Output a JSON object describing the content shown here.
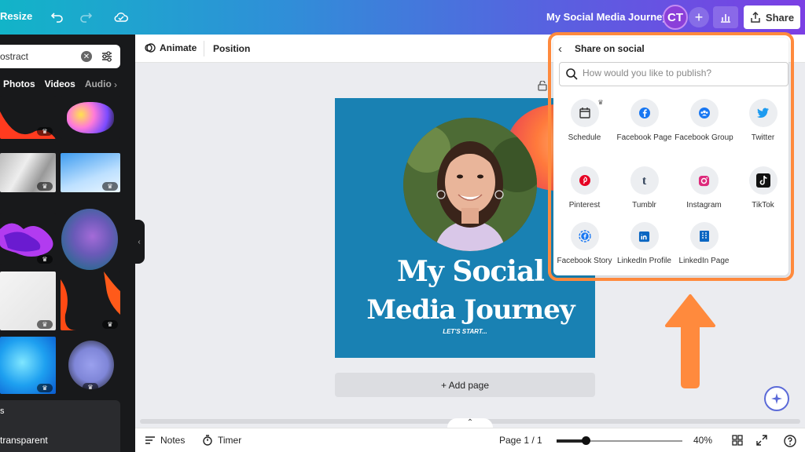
{
  "topbar": {
    "resize_label": "Resize",
    "doc_title": "My Social Media Journey",
    "avatar_initials": "CT",
    "plus": "+",
    "share_label": "Share"
  },
  "leftpanel": {
    "search_value": "ostract",
    "categories": [
      "Photos",
      "Videos",
      "Audio"
    ],
    "bottom_label_1": "s",
    "bottom_label_2": "transparent"
  },
  "canvas_toolbar": {
    "animate_label": "Animate",
    "position_label": "Position"
  },
  "design": {
    "title_line1": "My Social",
    "title_line2": "Media Journey",
    "subtitle": "LET'S START..."
  },
  "add_page_label": "+ Add page",
  "footer": {
    "notes_label": "Notes",
    "timer_label": "Timer",
    "page_label": "Page 1 / 1",
    "zoom_label": "40%",
    "zoom_level": 0.4
  },
  "share_popup": {
    "title": "Share on social",
    "search_placeholder": "How would you like to publish?",
    "options": [
      {
        "label": "Schedule",
        "icon": "calendar-icon"
      },
      {
        "label": "Facebook Page",
        "icon": "facebook-icon"
      },
      {
        "label": "Facebook Group",
        "icon": "facebook-group-icon"
      },
      {
        "label": "Twitter",
        "icon": "twitter-icon"
      },
      {
        "label": "Pinterest",
        "icon": "pinterest-icon"
      },
      {
        "label": "Tumblr",
        "icon": "tumblr-icon"
      },
      {
        "label": "Instagram",
        "icon": "instagram-icon"
      },
      {
        "label": "TikTok",
        "icon": "tiktok-icon"
      },
      {
        "label": "Facebook Story",
        "icon": "facebook-story-icon"
      },
      {
        "label": "LinkedIn Profile",
        "icon": "linkedin-icon"
      },
      {
        "label": "LinkedIn Page",
        "icon": "linkedin-page-icon"
      }
    ]
  },
  "colors": {
    "accent_orange": "#ff8a3d",
    "design_bg": "#1981b3",
    "topbar_start": "#12b4c8",
    "topbar_end": "#7b3fe4"
  }
}
